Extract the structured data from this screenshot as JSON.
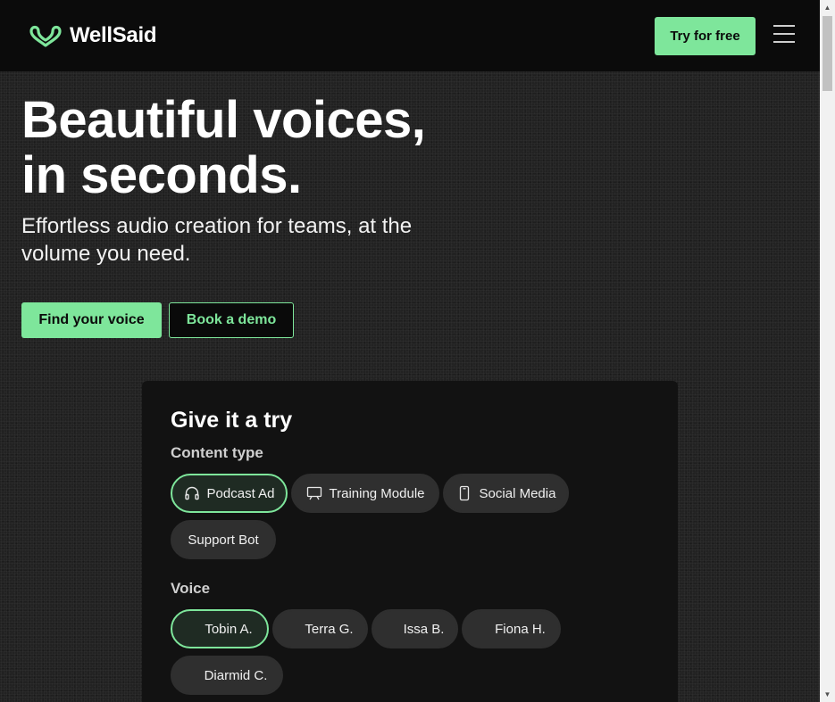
{
  "header": {
    "logo_text": "WellSaid",
    "try_label": "Try for free",
    "menu_icon": "hamburger-menu-icon"
  },
  "hero": {
    "title_line1": "Beautiful voices,",
    "title_line2": "in seconds.",
    "subtitle": "Effortless audio creation for teams, at the volume you need.",
    "find_voice_label": "Find your voice",
    "book_demo_label": "Book a demo"
  },
  "card": {
    "title": "Give it a try",
    "content_type_label": "Content type",
    "content_types": [
      {
        "label": "Podcast Ad",
        "icon": "headphones-icon",
        "selected": true
      },
      {
        "label": "Training Module",
        "icon": "presentation-icon",
        "selected": false
      },
      {
        "label": "Social Media",
        "icon": "phone-icon",
        "selected": false
      },
      {
        "label": "Support Bot",
        "icon": "",
        "selected": false
      }
    ],
    "voice_label": "Voice",
    "voices": [
      {
        "label": "Tobin A.",
        "selected": true
      },
      {
        "label": "Terra G.",
        "selected": false
      },
      {
        "label": "Issa B.",
        "selected": false
      },
      {
        "label": "Fiona H.",
        "selected": false
      },
      {
        "label": "Diarmid C.",
        "selected": false
      }
    ]
  },
  "colors": {
    "accent": "#7ee69b",
    "header_bg": "#0b0b0b",
    "card_bg": "#121212",
    "chip_bg": "#2f2f2f"
  }
}
